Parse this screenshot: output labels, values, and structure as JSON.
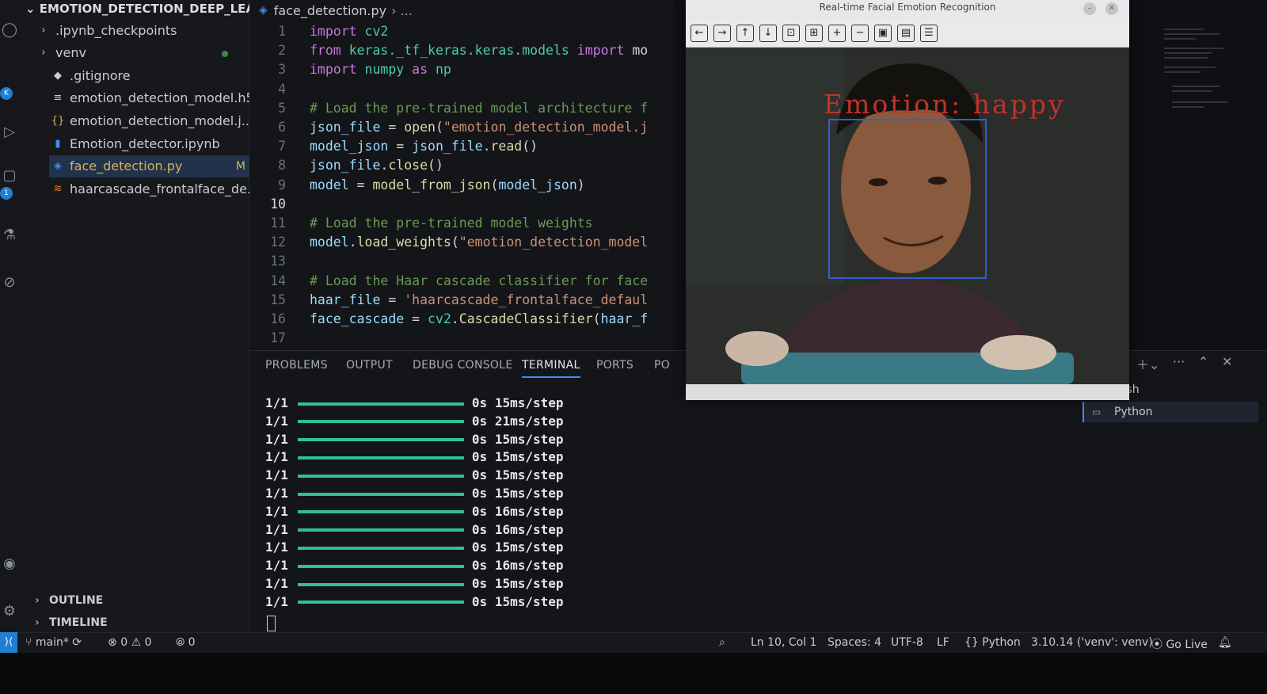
{
  "explorer": {
    "title": "EMOTION_DETECTION_DEEP_LEA...",
    "items": [
      {
        "label": ".ipynb_checkpoints",
        "icon": "chevron-right-icon",
        "glyph": "›"
      },
      {
        "label": "venv",
        "icon": "chevron-right-icon",
        "glyph": "›"
      },
      {
        "label": ".gitignore",
        "icon": "gitignore-file-icon",
        "glyph": "◆"
      },
      {
        "label": "emotion_detection_model.h5",
        "icon": "file-lines-icon",
        "glyph": "≡"
      },
      {
        "label": "emotion_detection_model.j...",
        "icon": "json-braces-icon",
        "glyph": "{}"
      },
      {
        "label": "Emotion_detector.ipynb",
        "icon": "notebook-icon",
        "glyph": "▮"
      },
      {
        "label": "face_detection.py",
        "icon": "python-file-icon",
        "glyph": "◈",
        "badge": "M"
      },
      {
        "label": "haarcascade_frontalface_de...",
        "icon": "xml-file-icon",
        "glyph": "≋"
      }
    ],
    "outline": "OUTLINE",
    "timeline": "TIMELINE"
  },
  "editor": {
    "breadcrumb_file": "face_detection.py",
    "breadcrumb_rest": "› ..."
  },
  "code_lines": [
    {
      "n": "1",
      "html": "<span class='kw'>import</span> <span class='md'>cv2</span>"
    },
    {
      "n": "2",
      "html": "<span class='kw'>from</span> <span class='md'>keras._tf_keras.keras.models</span> <span class='kw'>import</span> <span class='pl'>mo</span>"
    },
    {
      "n": "3",
      "html": "<span class='kw'>import</span> <span class='md'>numpy</span> <span class='kw'>as</span> <span class='md'>np</span>"
    },
    {
      "n": "4",
      "html": ""
    },
    {
      "n": "5",
      "html": "<span class='cm'># Load the pre-trained model architecture f</span>"
    },
    {
      "n": "6",
      "html": "<span class='id'>json_file</span> <span class='pl'>=</span> <span class='fn'>open</span><span class='pl'>(</span><span class='str'>\"emotion_detection_model.j</span>"
    },
    {
      "n": "7",
      "html": "<span class='id'>model_json</span> <span class='pl'>=</span> <span class='id'>json_file</span><span class='pl'>.</span><span class='fn'>read</span><span class='pl'>()</span>"
    },
    {
      "n": "8",
      "html": "<span class='id'>json_file</span><span class='pl'>.</span><span class='fn'>close</span><span class='pl'>()</span>"
    },
    {
      "n": "9",
      "html": "<span class='id'>model</span> <span class='pl'>=</span> <span class='fn'>model_from_json</span><span class='pl'>(</span><span class='id'>model_json</span><span class='pl'>)</span>"
    },
    {
      "n": "10",
      "html": "",
      "active": true
    },
    {
      "n": "11",
      "html": "<span class='cm'># Load the pre-trained model weights</span>"
    },
    {
      "n": "12",
      "html": "<span class='id'>model</span><span class='pl'>.</span><span class='fn'>load_weights</span><span class='pl'>(</span><span class='str'>\"emotion_detection_model</span>"
    },
    {
      "n": "13",
      "html": ""
    },
    {
      "n": "14",
      "html": "<span class='cm'># Load the Haar cascade classifier for face</span>"
    },
    {
      "n": "15",
      "html": "<span class='id'>haar_file</span> <span class='pl'>=</span> <span class='str'>'haarcascade_frontalface_defaul</span>"
    },
    {
      "n": "16",
      "html": "<span class='id'>face_cascade</span> <span class='pl'>=</span> <span class='md'>cv2</span><span class='pl'>.</span><span class='fn'>CascadeClassifier</span><span class='pl'>(</span><span class='id'>haar_f</span>"
    },
    {
      "n": "17",
      "html": ""
    }
  ],
  "panel": {
    "tabs": [
      "PROBLEMS",
      "OUTPUT",
      "DEBUG CONSOLE",
      "TERMINAL",
      "PORTS",
      "PO"
    ],
    "active_tab": "TERMINAL",
    "terminals": [
      {
        "label": "bash",
        "icon": "bash-icon"
      },
      {
        "label": "Python",
        "icon": "terminal-icon"
      }
    ]
  },
  "terminal_output": [
    {
      "count": "1/1",
      "time": "0s",
      "rate": "15ms/step"
    },
    {
      "count": "1/1",
      "time": "0s",
      "rate": "21ms/step"
    },
    {
      "count": "1/1",
      "time": "0s",
      "rate": "15ms/step"
    },
    {
      "count": "1/1",
      "time": "0s",
      "rate": "15ms/step"
    },
    {
      "count": "1/1",
      "time": "0s",
      "rate": "15ms/step"
    },
    {
      "count": "1/1",
      "time": "0s",
      "rate": "15ms/step"
    },
    {
      "count": "1/1",
      "time": "0s",
      "rate": "16ms/step"
    },
    {
      "count": "1/1",
      "time": "0s",
      "rate": "16ms/step"
    },
    {
      "count": "1/1",
      "time": "0s",
      "rate": "15ms/step"
    },
    {
      "count": "1/1",
      "time": "0s",
      "rate": "16ms/step"
    },
    {
      "count": "1/1",
      "time": "0s",
      "rate": "15ms/step"
    },
    {
      "count": "1/1",
      "time": "0s",
      "rate": "15ms/step"
    }
  ],
  "statusbar": {
    "branch": "main*",
    "errors": "0",
    "warnings": "0",
    "ports": "0",
    "position": "Ln 10, Col 1",
    "spaces": "Spaces: 4",
    "encoding": "UTF-8",
    "eol": "LF",
    "language": "Python",
    "interpreter": "3.10.14 ('venv': venv)",
    "golive": "Go Live"
  },
  "cv_window": {
    "title": "Real-time Facial Emotion Recognition",
    "emotion_text": "Emotion: happy",
    "toolbar_icons": [
      "arrow-left-icon",
      "arrow-right-icon",
      "arrow-up-icon",
      "arrow-down-icon",
      "zoom-fit-icon",
      "zoom-region-icon",
      "zoom-in-icon",
      "zoom-out-icon",
      "save-icon",
      "copy-icon",
      "properties-icon"
    ],
    "toolbar_glyphs": [
      "←",
      "→",
      "↑",
      "↓",
      "⊡",
      "⊞",
      "+",
      "−",
      "▣",
      "▤",
      "☰"
    ]
  },
  "colors": {
    "accent": "#3b8eea",
    "emotion_text": "#c0322c",
    "face_box": "#2f5fd0",
    "progress": "#2fbf9a"
  }
}
